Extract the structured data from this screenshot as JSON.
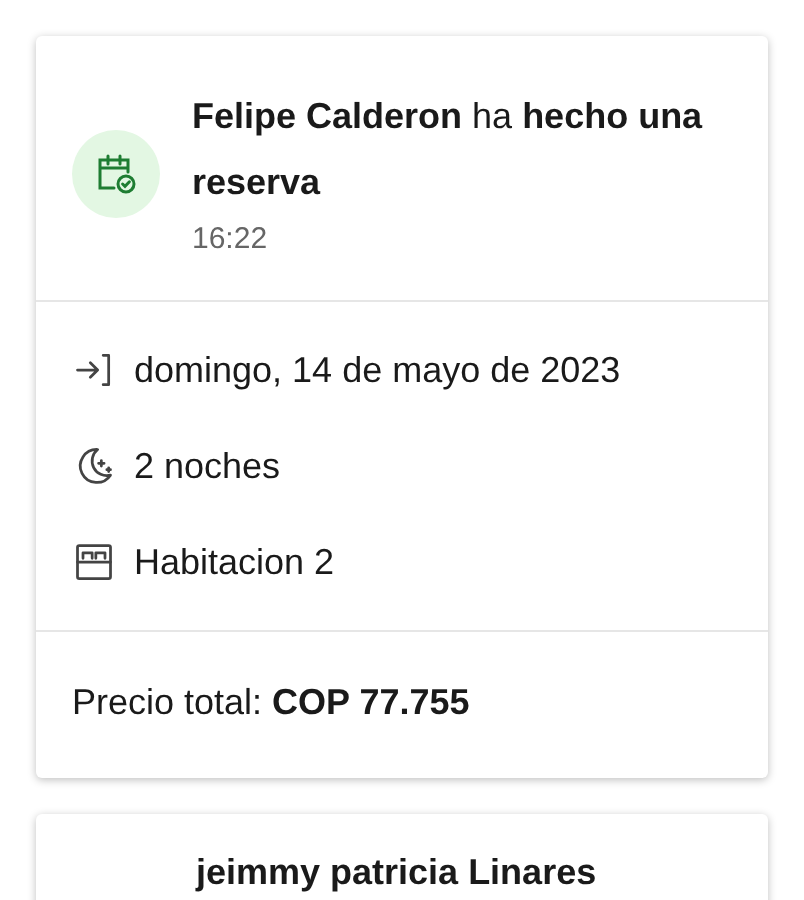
{
  "bookings": [
    {
      "title": "**Felipe Calderon** ha **hecho una reserva**",
      "time": "16:22",
      "details": [
        {
          "kind": "checkin",
          "text": "domingo, 14 de mayo de 2023"
        },
        {
          "kind": "nights",
          "text": "2 noches"
        },
        {
          "kind": "room",
          "text": "Habitacion 2"
        }
      ],
      "price_label": "Precio total:",
      "price": "COP 77.755"
    },
    {
      "title": "jeimmy patricia Linares"
    }
  ]
}
